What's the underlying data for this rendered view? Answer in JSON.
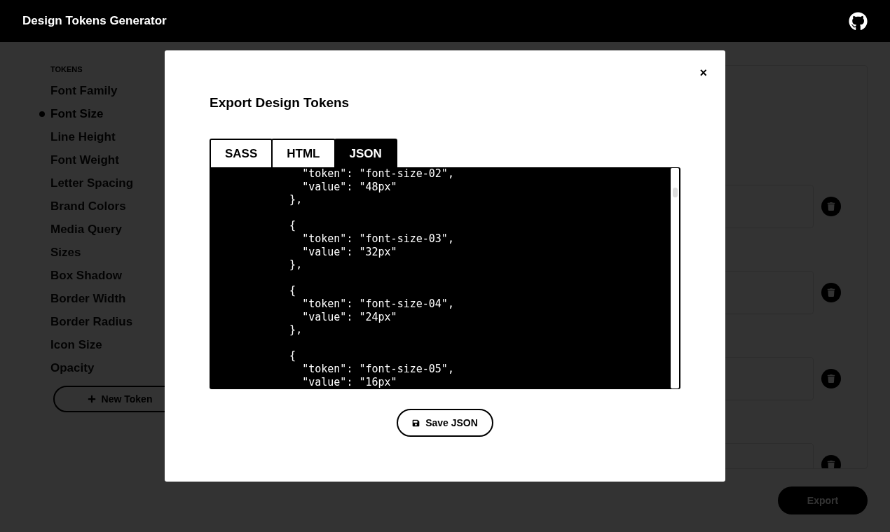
{
  "header": {
    "title": "Design Tokens Generator"
  },
  "sidebar": {
    "heading": "TOKENS",
    "items": [
      {
        "label": "Font Family",
        "selected": false
      },
      {
        "label": "Font Size",
        "selected": true
      },
      {
        "label": "Line Height",
        "selected": false
      },
      {
        "label": "Font Weight",
        "selected": false
      },
      {
        "label": "Letter Spacing",
        "selected": false
      },
      {
        "label": "Brand Colors",
        "selected": false
      },
      {
        "label": "Media Query",
        "selected": false
      },
      {
        "label": "Sizes",
        "selected": false
      },
      {
        "label": "Box Shadow",
        "selected": false
      },
      {
        "label": "Border Width",
        "selected": false
      },
      {
        "label": "Border Radius",
        "selected": false
      },
      {
        "label": "Icon Size",
        "selected": false
      },
      {
        "label": "Opacity",
        "selected": false
      }
    ],
    "new_token_button": "New Token"
  },
  "export_button": "Export",
  "modal": {
    "close": "×",
    "title": "Export Design Tokens",
    "tabs": [
      {
        "label": "SASS",
        "selected": false
      },
      {
        "label": "HTML",
        "selected": false
      },
      {
        "label": "JSON",
        "selected": true
      }
    ],
    "code": "      \"token\": \"font-size-02\",\n      \"value\": \"48px\"\n    },\n\n    {\n      \"token\": \"font-size-03\",\n      \"value\": \"32px\"\n    },\n\n    {\n      \"token\": \"font-size-04\",\n      \"value\": \"24px\"\n    },\n\n    {\n      \"token\": \"font-size-05\",\n      \"value\": \"16px\"",
    "save_button": "Save JSON"
  }
}
